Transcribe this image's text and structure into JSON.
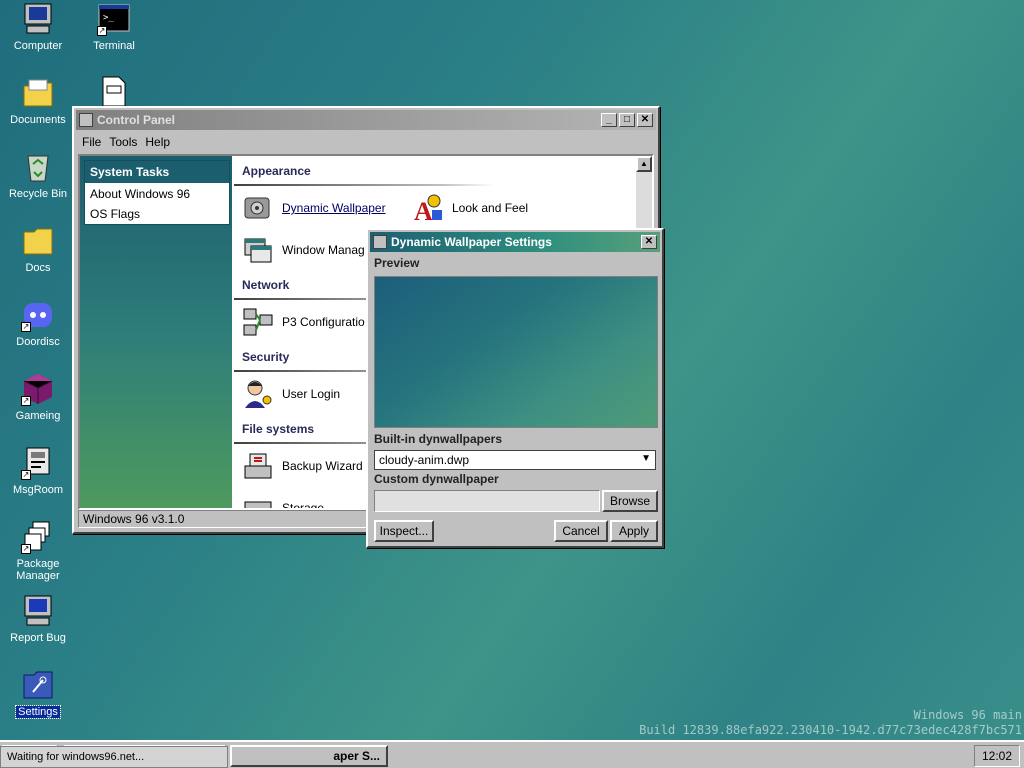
{
  "desktop": {
    "icons": [
      {
        "label": "Computer",
        "icon": "computer-icon"
      },
      {
        "label": "Terminal",
        "icon": "terminal-icon"
      },
      {
        "label": "Documents",
        "icon": "folder-documents-icon"
      },
      {
        "label": "Recycle Bin",
        "icon": "recycle-bin-icon"
      },
      {
        "label": "Docs",
        "icon": "folder-icon"
      },
      {
        "label": "Doordisc",
        "icon": "doordisc-icon"
      },
      {
        "label": "Gameing",
        "icon": "cube-icon"
      },
      {
        "label": "MsgRoom",
        "icon": "msgroom-icon"
      },
      {
        "label": "Package Manager",
        "icon": "package-manager-icon"
      },
      {
        "label": "Report Bug",
        "icon": "report-bug-icon"
      },
      {
        "label": "Settings",
        "icon": "settings-icon"
      }
    ]
  },
  "control_panel": {
    "title": "Control Panel",
    "menu": [
      "File",
      "Tools",
      "Help"
    ],
    "system_tasks": {
      "title": "System Tasks",
      "items": [
        "About Windows 96",
        "OS Flags"
      ]
    },
    "sections": {
      "appearance": "Appearance",
      "network": "Network",
      "security": "Security",
      "file_systems": "File systems"
    },
    "items": {
      "dynamic_wallpaper": "Dynamic Wallpaper",
      "look_and_feel": "Look and Feel",
      "window_manager": "Window Manag",
      "p3_configuration": "P3 Configuratio",
      "user_login": "User Login",
      "backup_wizard": "Backup Wizard",
      "storage": "Storage"
    },
    "status": "Windows 96 v3.1.0"
  },
  "dialog": {
    "title": "Dynamic Wallpaper Settings",
    "preview_label": "Preview",
    "builtin_label": "Built-in dynwallpapers",
    "builtin_value": "cloudy-anim.dwp",
    "custom_label": "Custom dynwallpaper",
    "custom_value": "",
    "browse": "Browse",
    "inspect": "Inspect...",
    "cancel": "Cancel",
    "apply": "Apply"
  },
  "taskbar": {
    "button_partial": "aper S...",
    "loading": "Waiting for windows96.net...",
    "clock": "12:02"
  },
  "watermark": {
    "line1": "Windows 96 main",
    "line2": "Build 12839.88efa922.230410-1942.d77c73edec428f7bc571"
  }
}
